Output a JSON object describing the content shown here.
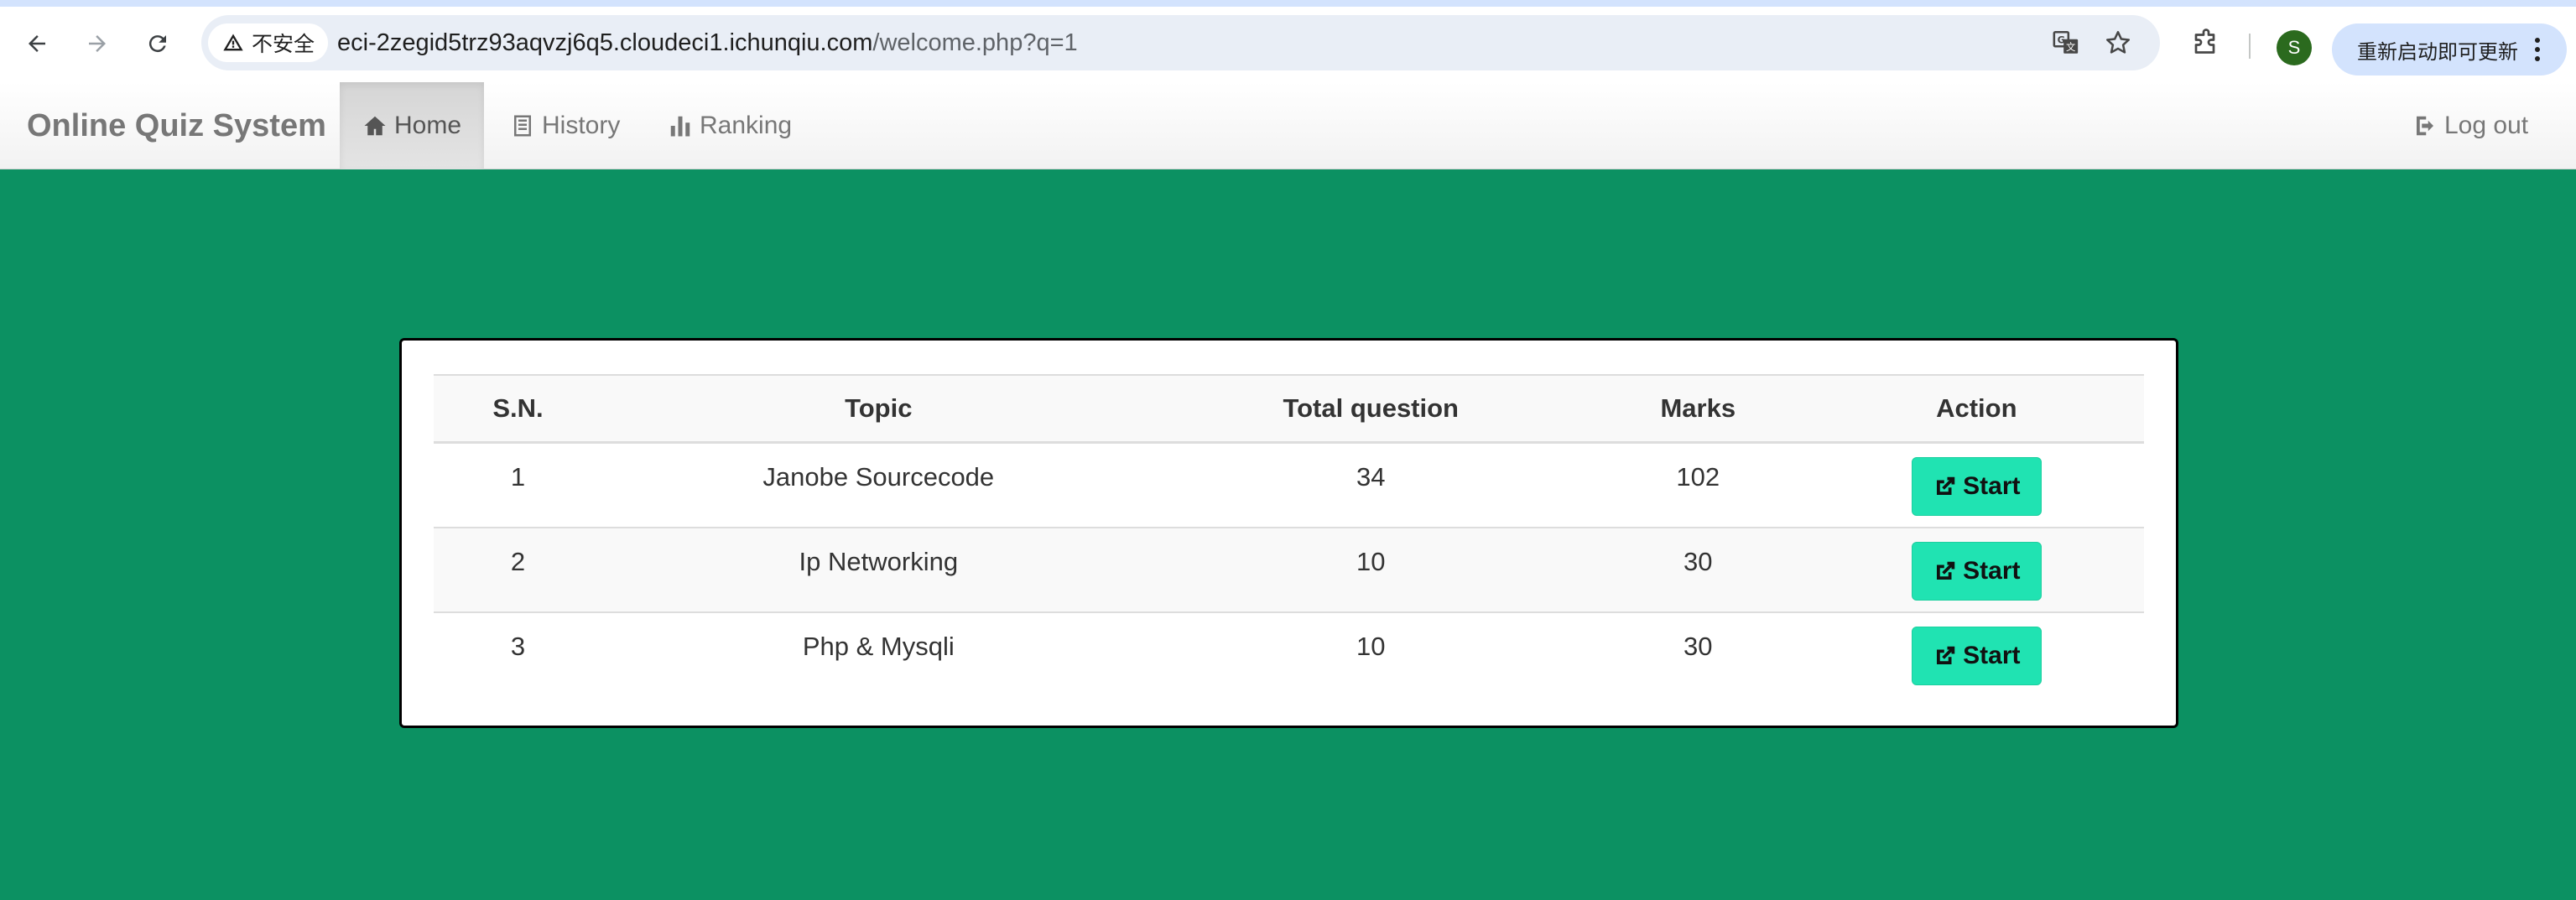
{
  "browser": {
    "security_label": "不安全",
    "url_host": "eci-2zegid5trz93aqvzj6q5.cloudeci1.ichunqiu.com",
    "url_path": "/welcome.php?q=1",
    "profile_initial": "S",
    "update_label": "重新启动即可更新",
    "icons": [
      "back-icon",
      "forward-icon",
      "reload-icon",
      "warning-icon",
      "translate-icon",
      "star-icon",
      "extensions-icon",
      "kebab-menu-icon"
    ]
  },
  "navbar": {
    "brand": "Online Quiz System",
    "items": [
      {
        "label": "Home",
        "icon": "home-icon",
        "active": true
      },
      {
        "label": "History",
        "icon": "history-icon",
        "active": false
      },
      {
        "label": "Ranking",
        "icon": "ranking-icon",
        "active": false
      }
    ],
    "logout_label": "Log out"
  },
  "quiz_table": {
    "headers": [
      "S.N.",
      "Topic",
      "Total question",
      "Marks",
      "Action"
    ],
    "rows": [
      {
        "sn": "1",
        "topic": "Janobe Sourcecode",
        "total": "34",
        "marks": "102",
        "action": "Start"
      },
      {
        "sn": "2",
        "topic": "Ip Networking",
        "total": "10",
        "marks": "30",
        "action": "Start"
      },
      {
        "sn": "3",
        "topic": "Php & Mysqli",
        "total": "10",
        "marks": "30",
        "action": "Start"
      }
    ]
  },
  "colors": {
    "page_background": "#0c9162",
    "start_button": "#20e3b2",
    "navbar_text": "#777777"
  }
}
